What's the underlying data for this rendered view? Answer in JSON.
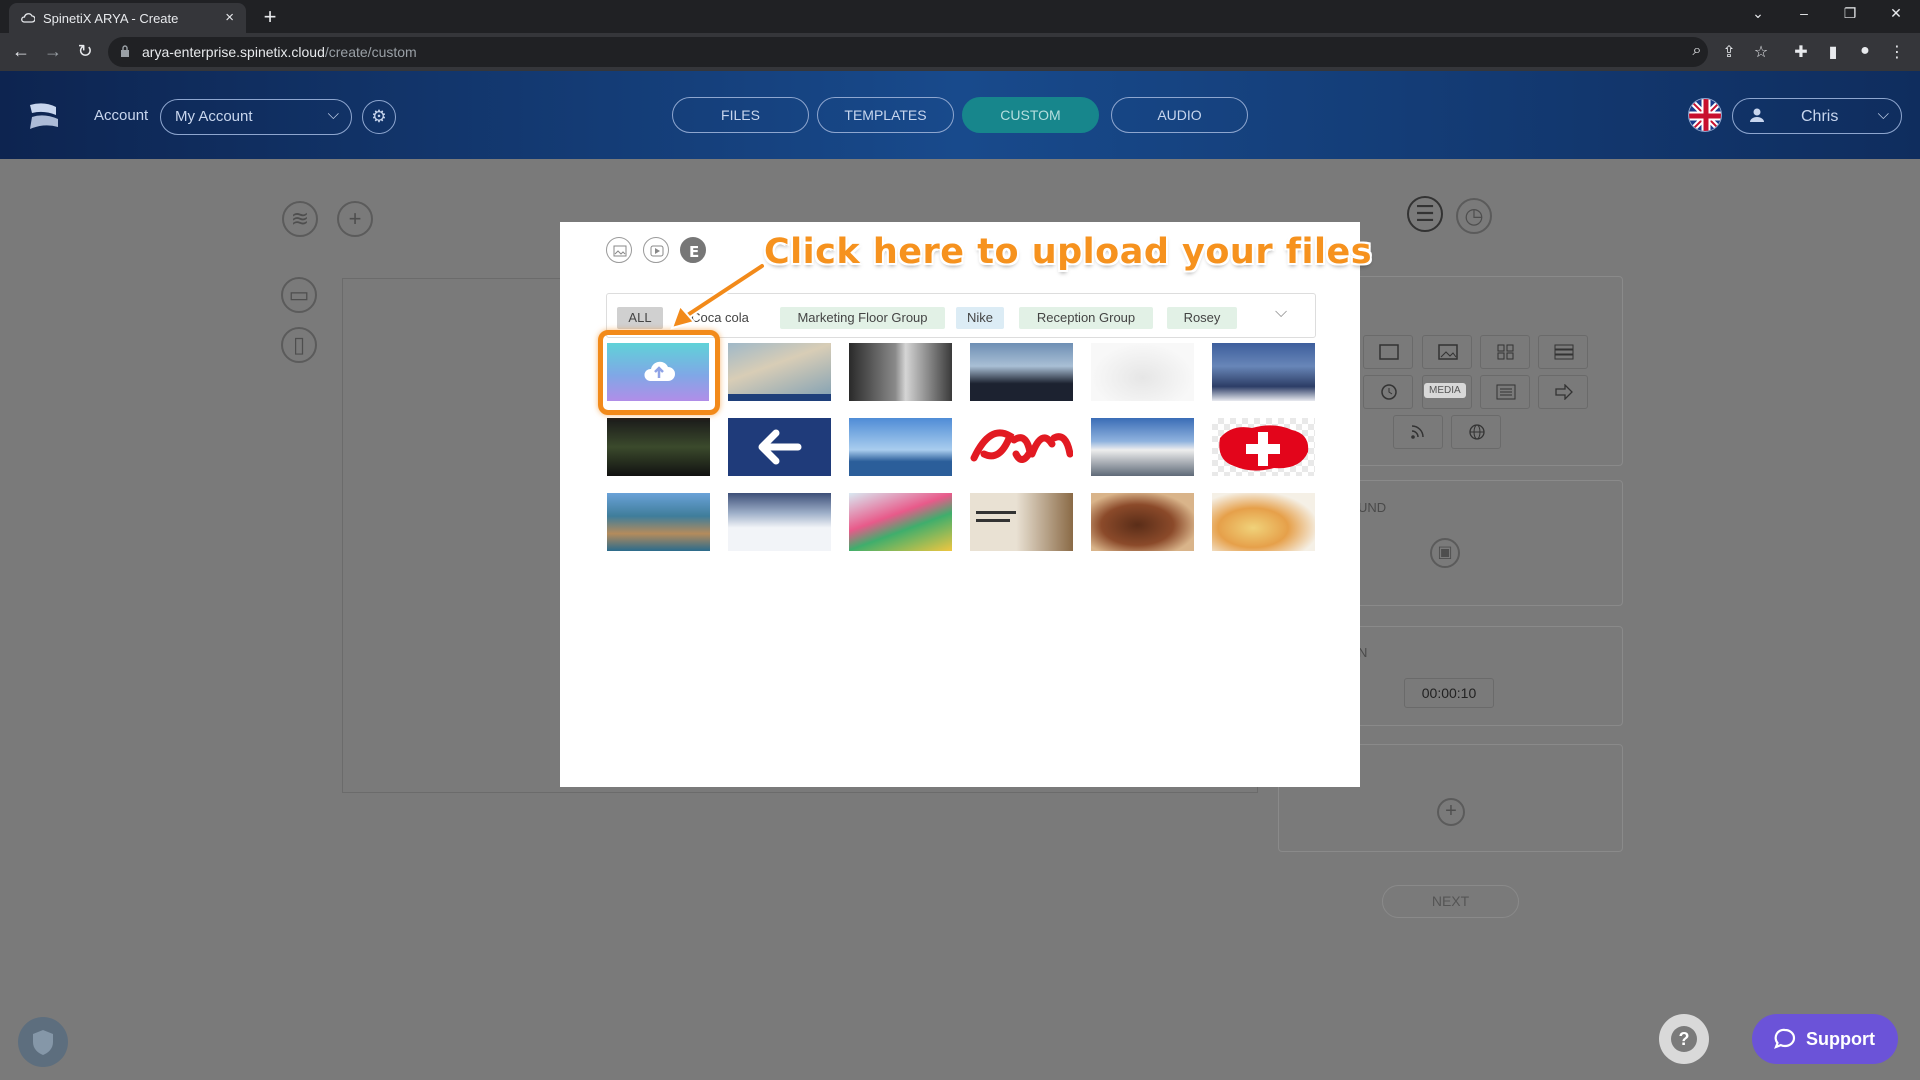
{
  "browser": {
    "tab_title": "SpinetiX ARYA - Create",
    "url_host": "arya-enterprise.spinetix.cloud",
    "url_path": "/create/custom"
  },
  "header": {
    "account_label": "Account",
    "account_value": "My Account",
    "nav": [
      "FILES",
      "TEMPLATES",
      "CUSTOM",
      "AUDIO"
    ],
    "active_nav": "CUSTOM",
    "user_name": "Chris",
    "accent_color": "#17868c"
  },
  "background_panel": {
    "media_tag": "MEDIA",
    "background_label": "UND",
    "duration_label": "N",
    "duration_value": "00:00:10",
    "next_label": "NEXT"
  },
  "modal": {
    "annotation": "Click here to upload your files",
    "filters": [
      "ALL",
      "Coca cola",
      "Marketing Floor Group",
      "Nike",
      "Reception Group",
      "Rosey"
    ],
    "active_filter": "ALL",
    "thumbnails": [
      "upload-tile",
      "money-notes",
      "astronaut",
      "graduation-caps",
      "white-sneakers",
      "snowy-village",
      "dark-video",
      "back-arrow",
      "lake-fountain",
      "coca-cola-logo",
      "mountain-peak",
      "swiss-flag",
      "city-aerial",
      "skier",
      "christmas-train",
      "university-selection",
      "grilled-meat",
      "food-platter"
    ]
  },
  "footer": {
    "support_label": "Support",
    "help_label": "?"
  }
}
